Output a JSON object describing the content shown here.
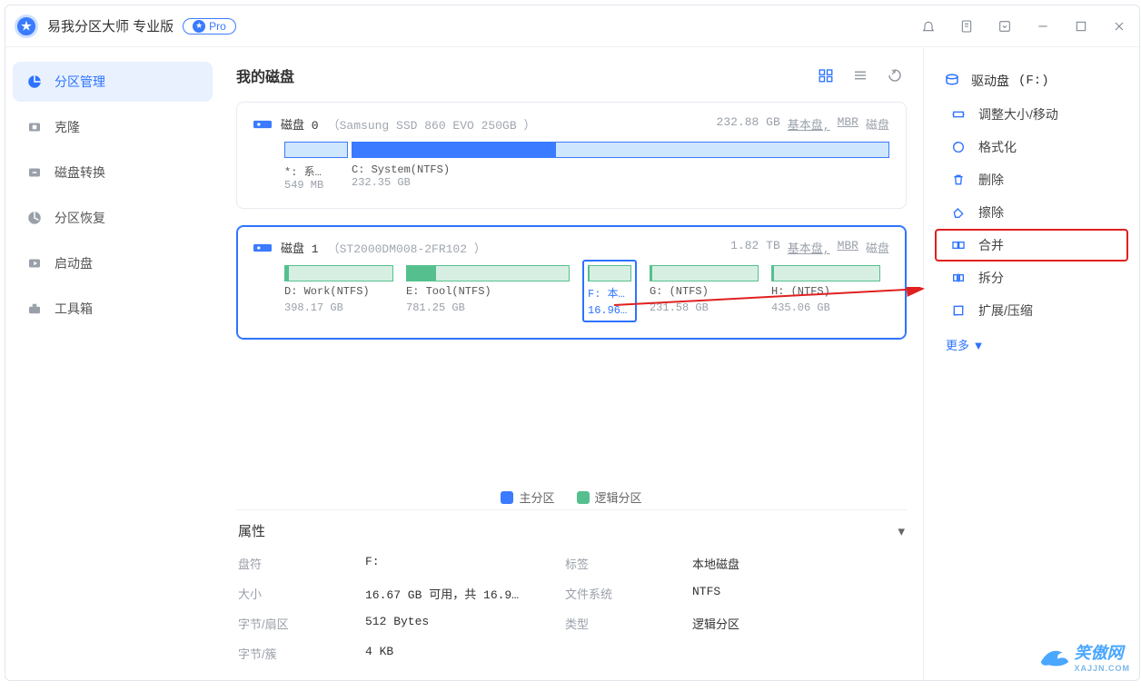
{
  "app": {
    "title": "易我分区大师 专业版",
    "pro_label": "Pro"
  },
  "sidebar": {
    "items": [
      {
        "label": "分区管理"
      },
      {
        "label": "克隆"
      },
      {
        "label": "磁盘转换"
      },
      {
        "label": "分区恢复"
      },
      {
        "label": "启动盘"
      },
      {
        "label": "工具箱"
      }
    ]
  },
  "main": {
    "heading": "我的磁盘"
  },
  "disks": [
    {
      "name": "磁盘 0",
      "model": "（Samsung SSD 860 EVO 250GB ）",
      "right": {
        "size": "232.88 GB",
        "type": "基本盘,",
        "part_style": "MBR",
        "noun": "磁盘"
      },
      "parts": [
        {
          "label": "*: 系…",
          "size": "549 MB"
        },
        {
          "label": "C: System(NTFS)",
          "size": "232.35 GB"
        }
      ]
    },
    {
      "name": "磁盘 1",
      "model": "（ST2000DM008-2FR102 ）",
      "right": {
        "size": "1.82 TB",
        "type": "基本盘,",
        "part_style": "MBR",
        "noun": "磁盘"
      },
      "parts": [
        {
          "label": "D: Work(NTFS)",
          "size": "398.17 GB",
          "fill": 3
        },
        {
          "label": "E: Tool(NTFS)",
          "size": "781.25 GB",
          "fill": 18
        },
        {
          "label": "F: 本…",
          "size": "16.96…",
          "fill": 2,
          "selected": true
        },
        {
          "label": "G: (NTFS)",
          "size": "231.58 GB",
          "fill": 2
        },
        {
          "label": "H: (NTFS)",
          "size": "435.06 GB",
          "fill": 2
        }
      ]
    }
  ],
  "legend": {
    "primary": "主分区",
    "logical": "逻辑分区"
  },
  "properties": {
    "heading": "属性",
    "rows": [
      {
        "k1": "盘符",
        "v1": "F:",
        "k2": "标签",
        "v2": "本地磁盘"
      },
      {
        "k1": "大小",
        "v1": "16.67 GB 可用，共 16.9…",
        "k2": "文件系统",
        "v2": "NTFS"
      },
      {
        "k1": "字节/扇区",
        "v1": "512 Bytes",
        "k2": "类型",
        "v2": "逻辑分区"
      },
      {
        "k1": "字节/簇",
        "v1": "4 KB",
        "k2": "",
        "v2": ""
      }
    ]
  },
  "actions": {
    "title_prefix": "驱动盘",
    "title_drive": "(F:)",
    "items": [
      {
        "label": "调整大小/移动"
      },
      {
        "label": "格式化"
      },
      {
        "label": "删除"
      },
      {
        "label": "擦除"
      },
      {
        "label": "合并",
        "hilite": true
      },
      {
        "label": "拆分"
      },
      {
        "label": "扩展/压缩"
      }
    ],
    "more": "更多 ▼"
  },
  "watermark": {
    "text": "笑傲网",
    "sub": "XAJJN.COM"
  }
}
